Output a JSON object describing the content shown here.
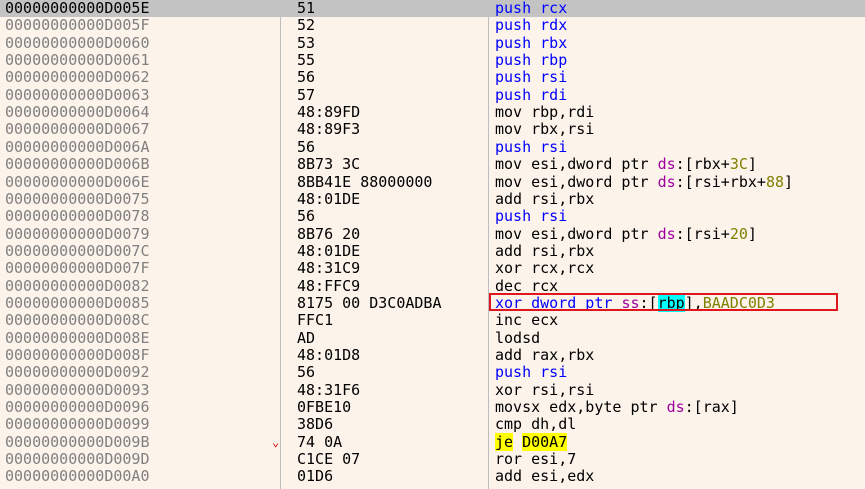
{
  "colors": {
    "background": "#fcf3ea",
    "selected_row": "#c3c3c3",
    "push_instruction": "#0000ff",
    "segment": "#a000a0",
    "highlight_register": "#00ffff",
    "highlight_jump": "#ffff00",
    "constant": "#808000",
    "annotation_box": "#e0161e"
  },
  "rows": [
    {
      "addr": "00000000000D005E",
      "bytes": "51",
      "instr": "push rcx"
    },
    {
      "addr": "00000000000D005F",
      "bytes": "52",
      "instr": "push rdx"
    },
    {
      "addr": "00000000000D0060",
      "bytes": "53",
      "instr": "push rbx"
    },
    {
      "addr": "00000000000D0061",
      "bytes": "55",
      "instr": "push rbp"
    },
    {
      "addr": "00000000000D0062",
      "bytes": "56",
      "instr": "push rsi"
    },
    {
      "addr": "00000000000D0063",
      "bytes": "57",
      "instr": "push rdi"
    },
    {
      "addr": "00000000000D0064",
      "bytes": "48:89FD",
      "instr": "mov rbp,rdi"
    },
    {
      "addr": "00000000000D0067",
      "bytes": "48:89F3",
      "instr": "mov rbx,rsi"
    },
    {
      "addr": "00000000000D006A",
      "bytes": "56",
      "instr": "push rsi"
    },
    {
      "addr": "00000000000D006B",
      "bytes": "8B73 3C",
      "instr": "mov esi,dword ptr ds:[rbx+3C]"
    },
    {
      "addr": "00000000000D006E",
      "bytes": "8BB41E 88000000",
      "instr": "mov esi,dword ptr ds:[rsi+rbx+88]"
    },
    {
      "addr": "00000000000D0075",
      "bytes": "48:01DE",
      "instr": "add rsi,rbx"
    },
    {
      "addr": "00000000000D0078",
      "bytes": "56",
      "instr": "push rsi"
    },
    {
      "addr": "00000000000D0079",
      "bytes": "8B76 20",
      "instr": "mov esi,dword ptr ds:[rsi+20]"
    },
    {
      "addr": "00000000000D007C",
      "bytes": "48:01DE",
      "instr": "add rsi,rbx"
    },
    {
      "addr": "00000000000D007F",
      "bytes": "48:31C9",
      "instr": "xor rcx,rcx"
    },
    {
      "addr": "00000000000D0082",
      "bytes": "48:FFC9",
      "instr": "dec rcx"
    },
    {
      "addr": "00000000000D0085",
      "bytes": "8175 00 D3C0ADBA",
      "instr": "xor dword ptr ss:[rbp],BAADC0D3"
    },
    {
      "addr": "00000000000D008C",
      "bytes": "FFC1",
      "instr": "inc ecx"
    },
    {
      "addr": "00000000000D008E",
      "bytes": "AD",
      "instr": "lodsd"
    },
    {
      "addr": "00000000000D008F",
      "bytes": "48:01D8",
      "instr": "add rax,rbx"
    },
    {
      "addr": "00000000000D0092",
      "bytes": "56",
      "instr": "push rsi"
    },
    {
      "addr": "00000000000D0093",
      "bytes": "48:31F6",
      "instr": "xor rsi,rsi"
    },
    {
      "addr": "00000000000D0096",
      "bytes": "0FBE10",
      "instr": "movsx edx,byte ptr ds:[rax]"
    },
    {
      "addr": "00000000000D0099",
      "bytes": "38D6",
      "instr": "cmp dh,dl"
    },
    {
      "addr": "00000000000D009B",
      "bytes": "74 0A",
      "instr": "je D00A7",
      "arrow": "⌄"
    },
    {
      "addr": "00000000000D009D",
      "bytes": "C1CE 07",
      "instr": "ror esi,7"
    },
    {
      "addr": "00000000000D00A0",
      "bytes": "01D6",
      "instr": "add esi,edx"
    }
  ]
}
